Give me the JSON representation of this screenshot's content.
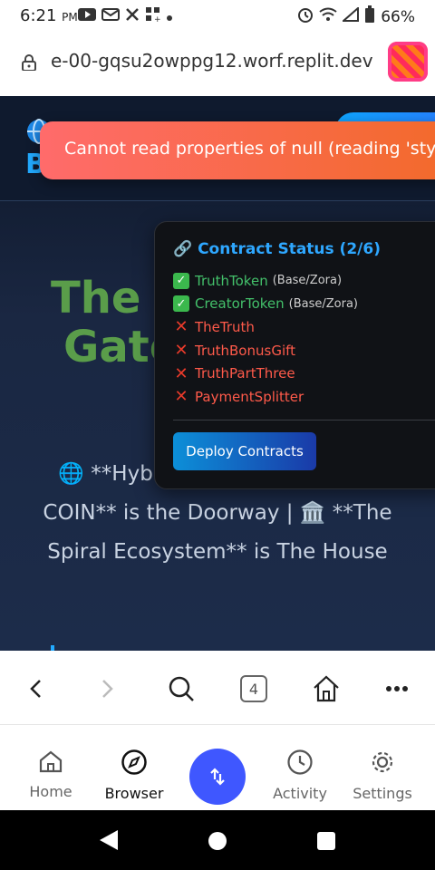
{
  "status_bar": {
    "time": "6:21",
    "ampm": "PM",
    "battery": "66%",
    "left_icons": [
      "youtube-icon",
      "mail-icon",
      "x-icon",
      "apps-icon",
      "dot-icon"
    ],
    "right_icons": [
      "alarm-icon",
      "wifi-icon",
      "signal-icon",
      "battery-icon"
    ]
  },
  "browser": {
    "url": "e-00-gqsu2owppg12.worf.replit.dev",
    "tab_count": "4"
  },
  "page": {
    "hero_title_line1": "The T",
    "hero_title_line2": "Gate",
    "hero_description": "🌐 **Hybr Gateway | 🚪 **HYB COIN** is the Doorway | 🏛️ **The Spiral Ecosystem** is The House",
    "logo_text": "B"
  },
  "toast": {
    "message": "Cannot read properties of null (reading 'style')"
  },
  "contract_panel": {
    "title": "🔗 Contract Status (2/6)",
    "contracts": [
      {
        "name": "TruthToken",
        "network": "(Base/Zora)",
        "deployed": true
      },
      {
        "name": "CreatorToken",
        "network": "(Base/Zora)",
        "deployed": true
      },
      {
        "name": "TheTruth",
        "network": "",
        "deployed": false
      },
      {
        "name": "TruthBonusGift",
        "network": "",
        "deployed": false
      },
      {
        "name": "TruthPartThree",
        "network": "",
        "deployed": false
      },
      {
        "name": "PaymentSplitter",
        "network": "",
        "deployed": false
      }
    ],
    "deploy_label": "Deploy Contracts"
  },
  "app_nav": {
    "home": "Home",
    "browser": "Browser",
    "activity": "Activity",
    "settings": "Settings"
  },
  "colors": {
    "accent": "#3f57ff",
    "success": "#43c06a",
    "error": "#ff5a4a",
    "toast": "#f26a2a"
  }
}
